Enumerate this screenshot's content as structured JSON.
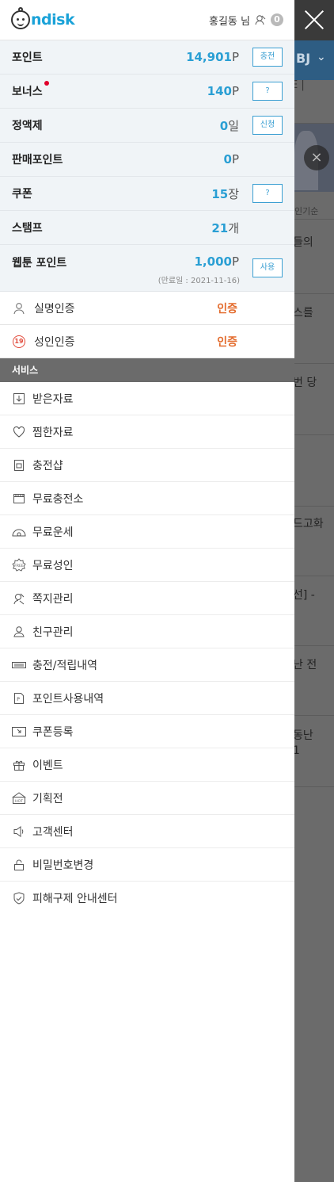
{
  "header": {
    "logo_text": "ndisk",
    "logo_letter": "O",
    "user_name": "홍길동 님",
    "message_count": "0"
  },
  "points": [
    {
      "label": "포인트",
      "value": "14,901",
      "unit": "P",
      "button": "충전"
    },
    {
      "label": "보너스",
      "value": "140",
      "unit": "P",
      "button": "?"
    },
    {
      "label": "정액제",
      "value": "0",
      "unit": "일",
      "button": "신청"
    },
    {
      "label": "판매포인트",
      "value": "0",
      "unit": "P",
      "button": ""
    },
    {
      "label": "쿠폰",
      "value": "15",
      "unit": "장",
      "button": "?"
    },
    {
      "label": "스탬프",
      "value": "21",
      "unit": "개",
      "button": ""
    },
    {
      "label": "웹툰 포인트",
      "value": "1,000",
      "unit": "P",
      "button": "사용",
      "note": "(만료일 : 2021-11-16)"
    }
  ],
  "certs": [
    {
      "label": "실명인증",
      "status": "인증",
      "icon": "person-icon"
    },
    {
      "label": "성인인증",
      "status": "인증",
      "icon": "adult-19-icon"
    }
  ],
  "services_title": "서비스",
  "services": [
    {
      "label": "받은자료",
      "icon": "download-box-icon"
    },
    {
      "label": "찜한자료",
      "icon": "heart-icon"
    },
    {
      "label": "충전샵",
      "icon": "shop-icon"
    },
    {
      "label": "무료충전소",
      "icon": "film-icon"
    },
    {
      "label": "무료운세",
      "icon": "fortune-icon"
    },
    {
      "label": "무료성인",
      "icon": "free-badge-icon"
    },
    {
      "label": "쪽지관리",
      "icon": "message-icon"
    },
    {
      "label": "친구관리",
      "icon": "friend-icon"
    },
    {
      "label": "충전/적립내역",
      "icon": "card-icon"
    },
    {
      "label": "포인트사용내역",
      "icon": "point-doc-icon"
    },
    {
      "label": "쿠폰등록",
      "icon": "coupon-icon"
    },
    {
      "label": "이벤트",
      "icon": "gift-icon"
    },
    {
      "label": "기획전",
      "icon": "hot-icon"
    },
    {
      "label": "고객센터",
      "icon": "speaker-icon"
    },
    {
      "label": "비밀번호변경",
      "icon": "lock-icon"
    },
    {
      "label": "피해구제 안내센터",
      "icon": "shield-icon"
    }
  ],
  "background": {
    "nav_text": "BJ",
    "sub_text": "E |",
    "sort_text": "인기순",
    "snippets": [
      "들의",
      "스를",
      "번 당",
      "드고화",
      "선] -",
      "난 전",
      "동난",
      "1"
    ]
  },
  "colors": {
    "accent_blue": "#2a9fd4",
    "status_orange": "#e36b2c",
    "section_gray": "#6b6b6b"
  }
}
